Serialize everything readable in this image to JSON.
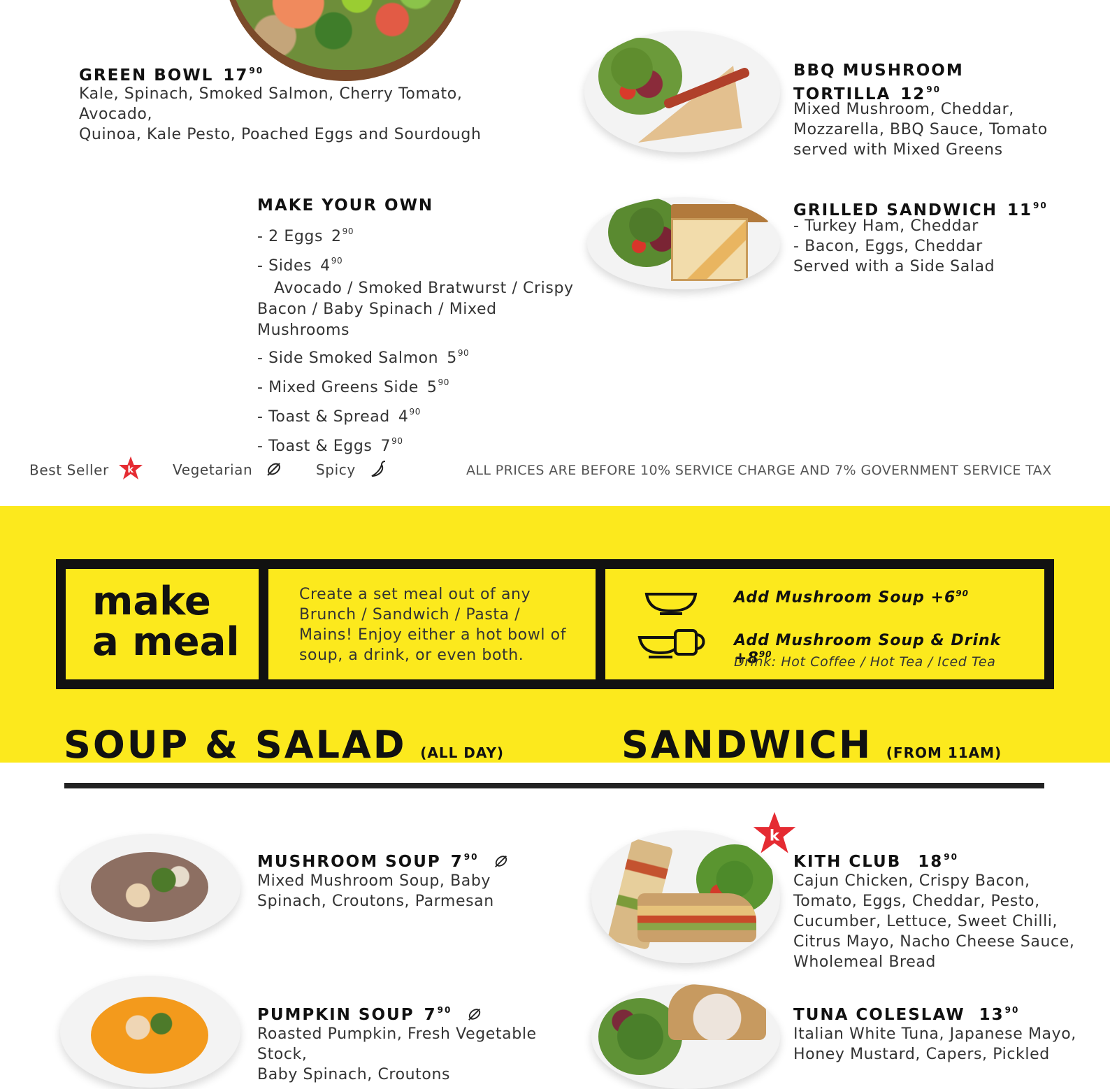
{
  "top": {
    "green_bowl": {
      "name": "GREEN BOWL",
      "price": "17",
      "cents": "90",
      "desc": [
        "Kale, Spinach, Smoked Salmon, Cherry Tomato, Avocado,",
        "Quinoa, Kale Pesto, Poached Eggs and Sourdough"
      ]
    },
    "bbq": {
      "name_line1": "BBQ MUSHROOM",
      "name_line2": "TORTILLA",
      "price": "12",
      "cents": "90",
      "desc": [
        "Mixed Mushroom, Cheddar,",
        "Mozzarella, BBQ Sauce, Tomato",
        "served with Mixed Greens"
      ]
    },
    "grilled": {
      "name": "GRILLED SANDWICH",
      "price": "11",
      "cents": "90",
      "desc": [
        "- Turkey Ham, Cheddar",
        "- Bacon, Eggs, Cheddar",
        "Served with a Side Salad"
      ]
    },
    "make_your_own": {
      "title": "MAKE YOUR OWN",
      "eggs": {
        "label": "- 2 Eggs",
        "price": "2",
        "cents": "90"
      },
      "sides": {
        "label": "- Sides",
        "price": "4",
        "cents": "90"
      },
      "sides_desc1": "Avocado / Smoked Bratwurst / Crispy",
      "sides_desc2": "Bacon / Baby Spinach / Mixed Mushrooms",
      "salmon": {
        "label": "- Side Smoked Salmon",
        "price": "5",
        "cents": "90"
      },
      "greens": {
        "label": "- Mixed Greens Side",
        "price": "5",
        "cents": "90"
      },
      "toast_spread": {
        "label": "- Toast & Spread",
        "price": "4",
        "cents": "90"
      },
      "toast_eggs": {
        "label": "- Toast & Eggs",
        "price": "7",
        "cents": "90"
      }
    }
  },
  "legend": {
    "best_seller": "Best Seller",
    "vegetarian": "Vegetarian",
    "spicy": "Spicy",
    "tax_note": "ALL PRICES ARE BEFORE 10% SERVICE CHARGE AND 7% GOVERNMENT SERVICE TAX"
  },
  "make_a_meal": {
    "title_line1": "make",
    "title_line2": "a meal",
    "desc": [
      "Create a set meal out of any",
      "Brunch / Sandwich / Pasta /",
      "Mains! Enjoy either a hot bowl of",
      "soup, a drink, or even both."
    ],
    "option1": {
      "label": "Add Mushroom Soup +6",
      "cents": "90"
    },
    "option2": {
      "label": "Add Mushroom Soup & Drink +8",
      "cents": "90"
    },
    "drink_note": "Drink: Hot Coffee / Hot Tea / Iced Tea"
  },
  "sections": {
    "soup_salad": {
      "title": "SOUP & SALAD",
      "note": "(ALL DAY)"
    },
    "sandwich": {
      "title": "SANDWICH",
      "note": "(FROM 11AM)"
    }
  },
  "bottom": {
    "mushroom_soup": {
      "name": "MUSHROOM SOUP",
      "price": "7",
      "cents": "90",
      "desc": [
        "Mixed Mushroom Soup, Baby",
        "Spinach, Croutons, Parmesan"
      ]
    },
    "pumpkin_soup": {
      "name": "PUMPKIN SOUP",
      "price": "7",
      "cents": "90",
      "desc": [
        "Roasted Pumpkin, Fresh Vegetable Stock,",
        "Baby Spinach, Croutons"
      ]
    },
    "kith_club": {
      "name": "KITH CLUB",
      "price": "18",
      "cents": "90",
      "desc": [
        "Cajun Chicken, Crispy Bacon,",
        "Tomato, Eggs, Cheddar, Pesto,",
        "Cucumber, Lettuce, Sweet Chilli,",
        "Citrus Mayo, Nacho Cheese Sauce,",
        "Wholemeal Bread"
      ]
    },
    "tuna": {
      "name": "TUNA COLESLAW",
      "price": "13",
      "cents": "90",
      "desc": [
        "Italian White Tuna, Japanese Mayo,",
        "Honey Mustard, Capers, Pickled"
      ]
    }
  },
  "colors": {
    "accent_yellow": "#fce91d",
    "star_red": "#e52b32",
    "ink": "#111111"
  },
  "icons": [
    "best-seller-star-icon",
    "vegetarian-leaf-icon",
    "spicy-chilli-icon",
    "soup-bowl-icon",
    "bowl-and-cup-icon"
  ]
}
